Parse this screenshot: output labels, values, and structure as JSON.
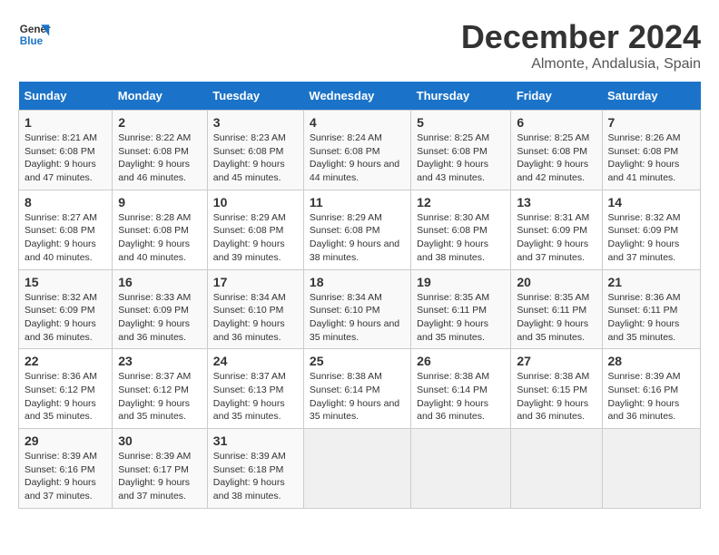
{
  "logo": {
    "line1": "General",
    "line2": "Blue"
  },
  "title": "December 2024",
  "subtitle": "Almonte, Andalusia, Spain",
  "headers": [
    "Sunday",
    "Monday",
    "Tuesday",
    "Wednesday",
    "Thursday",
    "Friday",
    "Saturday"
  ],
  "weeks": [
    [
      {
        "day": "1",
        "sunrise": "8:21 AM",
        "sunset": "6:08 PM",
        "daylight": "9 hours and 47 minutes."
      },
      {
        "day": "2",
        "sunrise": "8:22 AM",
        "sunset": "6:08 PM",
        "daylight": "9 hours and 46 minutes."
      },
      {
        "day": "3",
        "sunrise": "8:23 AM",
        "sunset": "6:08 PM",
        "daylight": "9 hours and 45 minutes."
      },
      {
        "day": "4",
        "sunrise": "8:24 AM",
        "sunset": "6:08 PM",
        "daylight": "9 hours and 44 minutes."
      },
      {
        "day": "5",
        "sunrise": "8:25 AM",
        "sunset": "6:08 PM",
        "daylight": "9 hours and 43 minutes."
      },
      {
        "day": "6",
        "sunrise": "8:25 AM",
        "sunset": "6:08 PM",
        "daylight": "9 hours and 42 minutes."
      },
      {
        "day": "7",
        "sunrise": "8:26 AM",
        "sunset": "6:08 PM",
        "daylight": "9 hours and 41 minutes."
      }
    ],
    [
      {
        "day": "8",
        "sunrise": "8:27 AM",
        "sunset": "6:08 PM",
        "daylight": "9 hours and 40 minutes."
      },
      {
        "day": "9",
        "sunrise": "8:28 AM",
        "sunset": "6:08 PM",
        "daylight": "9 hours and 40 minutes."
      },
      {
        "day": "10",
        "sunrise": "8:29 AM",
        "sunset": "6:08 PM",
        "daylight": "9 hours and 39 minutes."
      },
      {
        "day": "11",
        "sunrise": "8:29 AM",
        "sunset": "6:08 PM",
        "daylight": "9 hours and 38 minutes."
      },
      {
        "day": "12",
        "sunrise": "8:30 AM",
        "sunset": "6:08 PM",
        "daylight": "9 hours and 38 minutes."
      },
      {
        "day": "13",
        "sunrise": "8:31 AM",
        "sunset": "6:09 PM",
        "daylight": "9 hours and 37 minutes."
      },
      {
        "day": "14",
        "sunrise": "8:32 AM",
        "sunset": "6:09 PM",
        "daylight": "9 hours and 37 minutes."
      }
    ],
    [
      {
        "day": "15",
        "sunrise": "8:32 AM",
        "sunset": "6:09 PM",
        "daylight": "9 hours and 36 minutes."
      },
      {
        "day": "16",
        "sunrise": "8:33 AM",
        "sunset": "6:09 PM",
        "daylight": "9 hours and 36 minutes."
      },
      {
        "day": "17",
        "sunrise": "8:34 AM",
        "sunset": "6:10 PM",
        "daylight": "9 hours and 36 minutes."
      },
      {
        "day": "18",
        "sunrise": "8:34 AM",
        "sunset": "6:10 PM",
        "daylight": "9 hours and 35 minutes."
      },
      {
        "day": "19",
        "sunrise": "8:35 AM",
        "sunset": "6:11 PM",
        "daylight": "9 hours and 35 minutes."
      },
      {
        "day": "20",
        "sunrise": "8:35 AM",
        "sunset": "6:11 PM",
        "daylight": "9 hours and 35 minutes."
      },
      {
        "day": "21",
        "sunrise": "8:36 AM",
        "sunset": "6:11 PM",
        "daylight": "9 hours and 35 minutes."
      }
    ],
    [
      {
        "day": "22",
        "sunrise": "8:36 AM",
        "sunset": "6:12 PM",
        "daylight": "9 hours and 35 minutes."
      },
      {
        "day": "23",
        "sunrise": "8:37 AM",
        "sunset": "6:12 PM",
        "daylight": "9 hours and 35 minutes."
      },
      {
        "day": "24",
        "sunrise": "8:37 AM",
        "sunset": "6:13 PM",
        "daylight": "9 hours and 35 minutes."
      },
      {
        "day": "25",
        "sunrise": "8:38 AM",
        "sunset": "6:14 PM",
        "daylight": "9 hours and 35 minutes."
      },
      {
        "day": "26",
        "sunrise": "8:38 AM",
        "sunset": "6:14 PM",
        "daylight": "9 hours and 36 minutes."
      },
      {
        "day": "27",
        "sunrise": "8:38 AM",
        "sunset": "6:15 PM",
        "daylight": "9 hours and 36 minutes."
      },
      {
        "day": "28",
        "sunrise": "8:39 AM",
        "sunset": "6:16 PM",
        "daylight": "9 hours and 36 minutes."
      }
    ],
    [
      {
        "day": "29",
        "sunrise": "8:39 AM",
        "sunset": "6:16 PM",
        "daylight": "9 hours and 37 minutes."
      },
      {
        "day": "30",
        "sunrise": "8:39 AM",
        "sunset": "6:17 PM",
        "daylight": "9 hours and 37 minutes."
      },
      {
        "day": "31",
        "sunrise": "8:39 AM",
        "sunset": "6:18 PM",
        "daylight": "9 hours and 38 minutes."
      },
      null,
      null,
      null,
      null
    ]
  ]
}
